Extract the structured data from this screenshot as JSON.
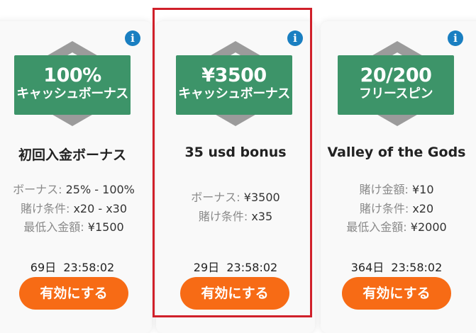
{
  "info_glyph": "i",
  "cards": [
    {
      "badge_amount": "100%",
      "badge_type": "キャッシュボーナス",
      "title": "初回入金ボーナス",
      "details": [
        {
          "label": "ボーナス:",
          "value": "25% - 100%"
        },
        {
          "label": "賭け条件:",
          "value": "x20 - x30"
        },
        {
          "label": "最低入金額:",
          "value": "¥1500"
        }
      ],
      "timer_days": "69日",
      "timer_time": "23:58:02",
      "button_label": "有効にする",
      "selected": false
    },
    {
      "badge_amount": "¥3500",
      "badge_type": "キャッシュボーナス",
      "title": "35 usd bonus",
      "details": [
        {
          "label": "ボーナス:",
          "value": "¥3500"
        },
        {
          "label": "賭け条件:",
          "value": "x35"
        }
      ],
      "timer_days": "29日",
      "timer_time": "23:58:02",
      "button_label": "有効にする",
      "selected": true
    },
    {
      "badge_amount": "20/200",
      "badge_type": "フリースピン",
      "title": "Valley of the Gods",
      "details": [
        {
          "label": "賭け金額:",
          "value": "¥10"
        },
        {
          "label": "賭け条件:",
          "value": "x20"
        },
        {
          "label": "最低入金額:",
          "value": "¥2000"
        }
      ],
      "timer_days": "364日",
      "timer_time": "23:58:02",
      "button_label": "有効にする",
      "selected": false
    }
  ],
  "colors": {
    "badge_green": "#3d9469",
    "button_orange": "#f76b15",
    "info_blue": "#1a7fc1",
    "selection_red": "#d0202a"
  }
}
